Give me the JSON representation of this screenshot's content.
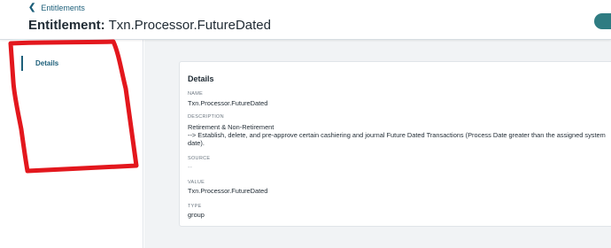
{
  "header": {
    "back_label": "Entitlements",
    "title_prefix": "Entitlement:",
    "title_name": "Txn.Processor.FutureDated"
  },
  "sidebar": {
    "items": [
      {
        "label": "Details",
        "active": true
      }
    ]
  },
  "details": {
    "title": "Details",
    "name_label": "NAME",
    "name_value": "Txn.Processor.FutureDated",
    "description_label": "DESCRIPTION",
    "description_line1": "Retirement & Non-Retirement",
    "description_line2": "--> Establish, delete, and pre-approve certain cashiering and journal Future Dated Transactions (Process Date greater than the assigned system date).",
    "source_label": "SOURCE",
    "source_value": "--",
    "value_label": "VALUE",
    "value_value": "Txn.Processor.FutureDated",
    "type_label": "TYPE",
    "type_value": "group"
  },
  "colors": {
    "accent": "#1d5f7a",
    "button": "#2f7c82",
    "annotation": "#e3171d",
    "content_background": "#f1f3f5"
  },
  "icons": {
    "back": "chevron-left-icon"
  }
}
